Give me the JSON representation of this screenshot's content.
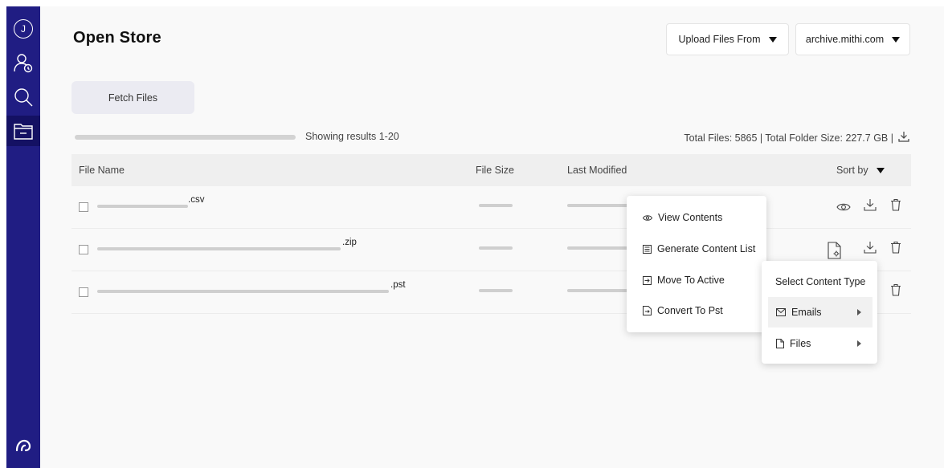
{
  "app": {
    "title": "Open Store",
    "user_initial": "J"
  },
  "header": {
    "upload_label": "Upload Files From",
    "domain_label": "archive.mithi.com"
  },
  "toolbar": {
    "fetch_label": "Fetch Files",
    "showing": "Showing results 1-20",
    "totals": "Total Files: 5865 | Total Folder Size: 227.7 GB |"
  },
  "table": {
    "columns": {
      "name": "File Name",
      "size": "File Size",
      "modified": "Last Modified",
      "sort": "Sort by"
    },
    "rows": [
      {
        "ext": ".csv"
      },
      {
        "ext": ".zip"
      },
      {
        "ext": ".pst"
      }
    ]
  },
  "actions_menu": {
    "items": [
      "View Contents",
      "Generate Content List",
      "Move To Active",
      "Convert To Pst"
    ]
  },
  "types_menu": {
    "header": "Select Content Type",
    "items": [
      "Emails",
      "Files"
    ]
  },
  "colors": {
    "sidebar": "#201d83",
    "sidebar_active": "#141163",
    "background": "#f9f9f9"
  }
}
